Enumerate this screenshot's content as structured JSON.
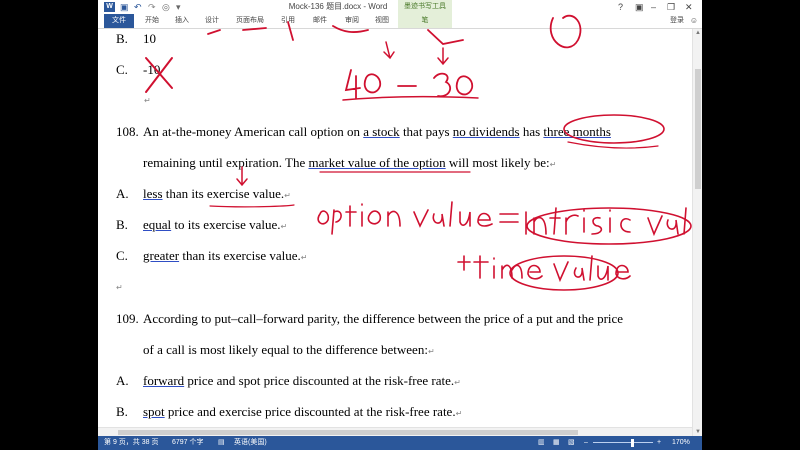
{
  "titlebar": {
    "doc_title": "Mock-136 题目.docx - Word",
    "context_tab": "墨迹书写工具",
    "help": "?",
    "minimize": "–",
    "restore": "❐",
    "close": "✕"
  },
  "ribbon": {
    "tabs": [
      "文件",
      "开始",
      "插入",
      "设计",
      "页面布局",
      "引用",
      "邮件",
      "审阅",
      "视图",
      "笔"
    ],
    "login": "登录"
  },
  "document": {
    "prev_options": [
      {
        "letter": "B.",
        "text": "10"
      },
      {
        "letter": "C.",
        "text": "-10"
      }
    ],
    "q108": {
      "number": "108.",
      "line1": {
        "p1": "An at-the-money American call option on ",
        "u1": "a stock",
        "p2": " that pays ",
        "u2": "no dividends",
        "p3": " has ",
        "u3": "three months"
      },
      "line2": {
        "p1": "remaining until expiration. The ",
        "u1": "market value of the option",
        "p2": " will most likely be:"
      },
      "options": [
        {
          "letter": "A.",
          "key": "less",
          "rest": " than its exercise value."
        },
        {
          "letter": "B.",
          "key": "equal",
          "rest": " to its exercise value."
        },
        {
          "letter": "C.",
          "key": "greater",
          "rest": " than its exercise value."
        }
      ]
    },
    "q109": {
      "number": "109.",
      "line1": "According to put–call–forward parity, the difference between the price of a put and the price",
      "line2": "of a call is most likely equal to the difference between:",
      "options": [
        {
          "letter": "A.",
          "key": "forward",
          "rest": " price and spot price discounted at the risk-free rate."
        },
        {
          "letter": "B.",
          "key": "spot",
          "rest": " price and exercise price discounted at the risk-free rate."
        }
      ]
    }
  },
  "statusbar": {
    "page": "第 9 页，共 38 页",
    "words": "6797 个字",
    "language": "英语(美国)",
    "zoom": "170%",
    "minus": "–",
    "plus": "+"
  }
}
